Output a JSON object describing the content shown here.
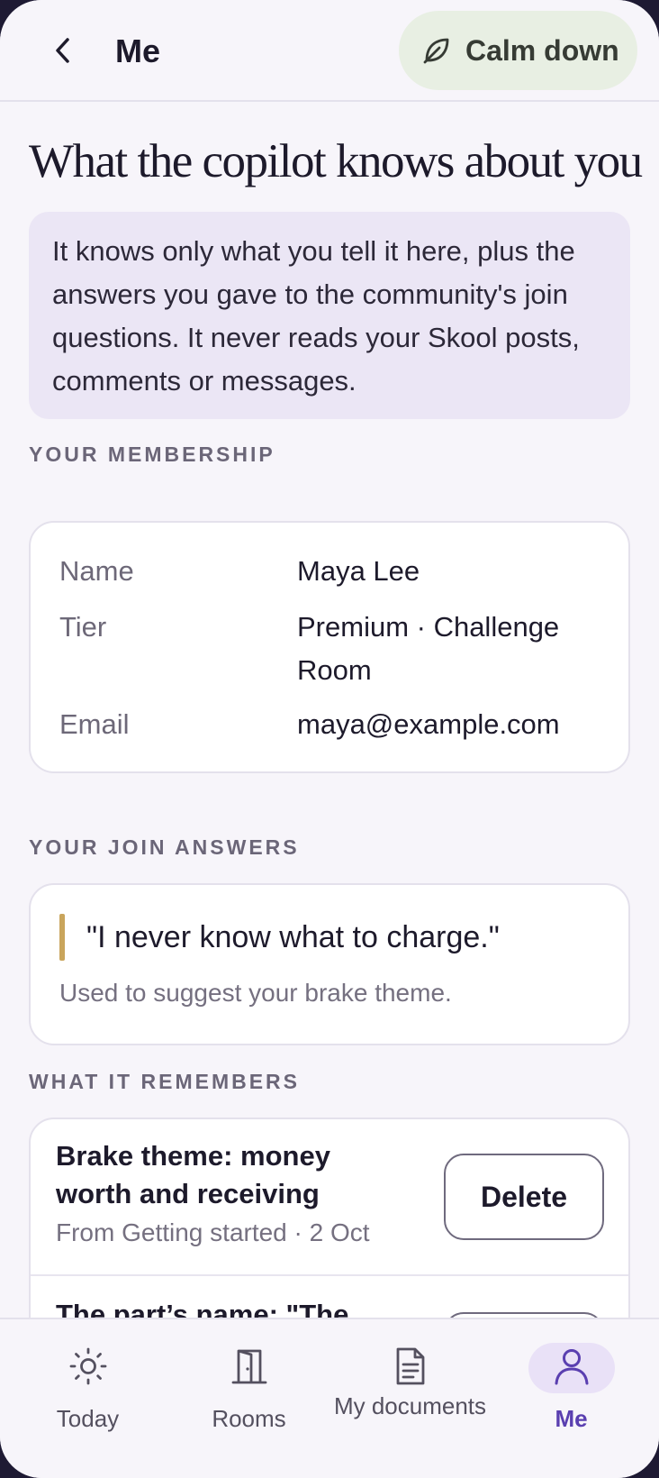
{
  "header": {
    "title": "Me",
    "calm_button_label": "Calm down"
  },
  "page": {
    "title": "What the copilot knows about you",
    "info": "It knows only what you tell it here, plus the answers you gave to the community's join questions. It never reads your Skool posts, comments or messages."
  },
  "membership": {
    "section_label": "YOUR MEMBERSHIP",
    "rows": [
      {
        "key": "Name",
        "value": "Maya Lee"
      },
      {
        "key": "Tier",
        "value": "Premium · Challenge Room"
      },
      {
        "key": "Email",
        "value": "maya@example.com"
      }
    ]
  },
  "join_answers": {
    "section_label": "YOUR JOIN ANSWERS",
    "quote": "\"I never know what to charge.\"",
    "note": "Used to suggest your brake theme."
  },
  "memory": {
    "section_label": "WHAT IT REMEMBERS",
    "items": [
      {
        "title": "Brake theme: money worth and receiving",
        "meta": "From Getting started · 2 Oct",
        "delete_label": "Delete"
      },
      {
        "title": "The part’s name: \"The",
        "delete_label": "Delete"
      }
    ]
  },
  "nav": {
    "items": [
      {
        "label": "Today",
        "icon": "sun-icon"
      },
      {
        "label": "Rooms",
        "icon": "door-icon"
      },
      {
        "label": "My documents",
        "icon": "document-icon"
      },
      {
        "label": "Me",
        "icon": "person-icon",
        "active": true
      }
    ]
  },
  "colors": {
    "accent": "#5a3fb0",
    "info_bg": "#ebe6f5",
    "calm_bg": "#e8efe3",
    "quote_bar": "#c9a55c"
  }
}
